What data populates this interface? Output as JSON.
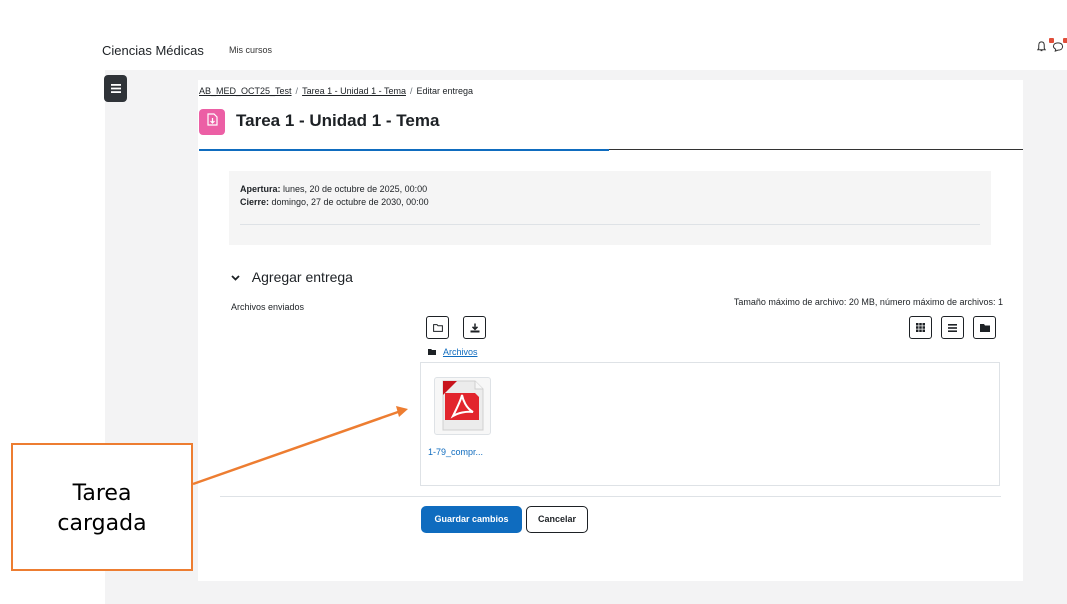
{
  "navbar": {
    "brand": "Ciencias Médicas",
    "mis_cursos": "Mis cursos",
    "icons": [
      "bell-icon",
      "chat-icon"
    ]
  },
  "breadcrumb": {
    "course": "AB_MED_OCT25_Test",
    "assignment": "Tarea 1 - Unidad 1 - Tema",
    "current": "Editar entrega"
  },
  "page": {
    "title": "Tarea 1 - Unidad 1 - Tema",
    "icon_color": "#ec5fa5"
  },
  "dates": {
    "opening_label": "Apertura:",
    "opening_value": " lunes, 20 de octubre de 2025, 00:00",
    "closing_label": "Cierre:",
    "closing_value": " domingo, 27 de octubre de 2030, 00:00"
  },
  "submission": {
    "section_title": "Agregar entrega",
    "field_label": "Archivos enviados",
    "max_size_text": "Tamaño máximo de archivo: 20 MB, número máximo de archivos: 1",
    "folder_link": "Archivos",
    "file_name": "1-79_compr..."
  },
  "buttons": {
    "save": "Guardar cambios",
    "cancel": "Cancelar"
  },
  "annotation": {
    "line1": "Tarea",
    "line2": "cargada",
    "color": "#ed7d31"
  },
  "colors": {
    "primary": "#0f6cbf",
    "page_bg": "#f3f3f4"
  }
}
